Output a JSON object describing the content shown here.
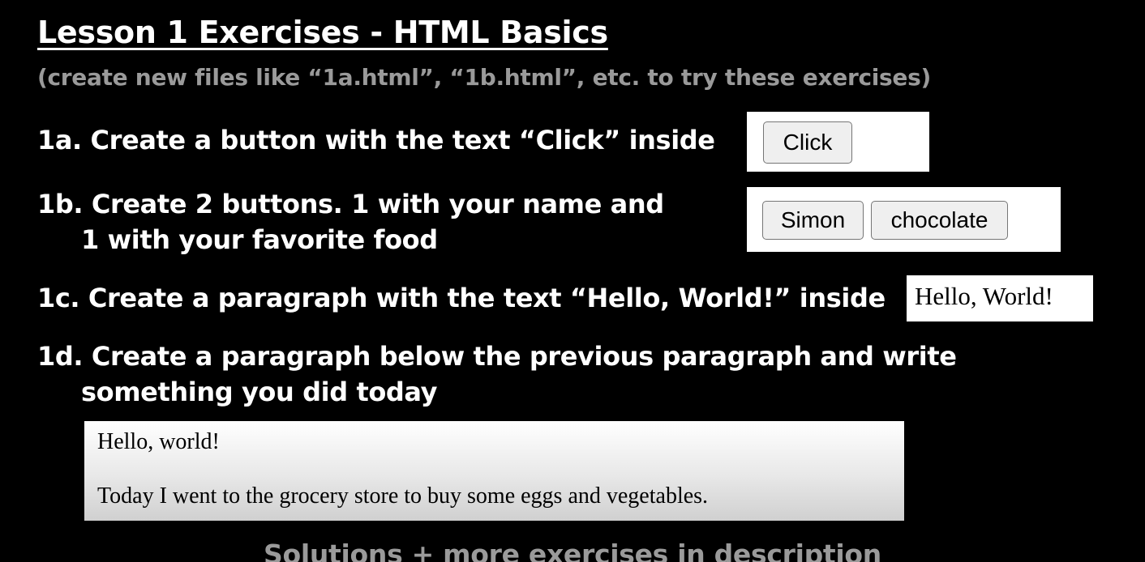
{
  "header": {
    "title": "Lesson 1  Exercises - HTML Basics",
    "subtitle": "(create new files like “1a.html”, “1b.html”, etc. to try these exercises)"
  },
  "exercises": {
    "ex1a": {
      "text": "1a. Create a button with the text “Click” inside",
      "demo_button": "Click"
    },
    "ex1b": {
      "line1": "1b. Create 2 buttons. 1 with your name and",
      "line2": "1 with your favorite food",
      "demo_buttons": [
        "Simon",
        "chocolate"
      ]
    },
    "ex1c": {
      "text": "1c. Create a paragraph with the text “Hello, World!” inside",
      "demo_text": "Hello, World!"
    },
    "ex1d": {
      "line1": "1d. Create a paragraph below the previous paragraph and write",
      "line2": "something you did today",
      "demo_paragraphs": [
        "Hello, world!",
        "Today I went to the grocery store to buy some eggs and vegetables."
      ]
    }
  },
  "footer": {
    "text": "Solutions + more exercises in description"
  },
  "colors": {
    "background": "#000000",
    "text": "#ffffff",
    "muted_text": "#9a9a9a",
    "demo_background": "#ffffff"
  }
}
